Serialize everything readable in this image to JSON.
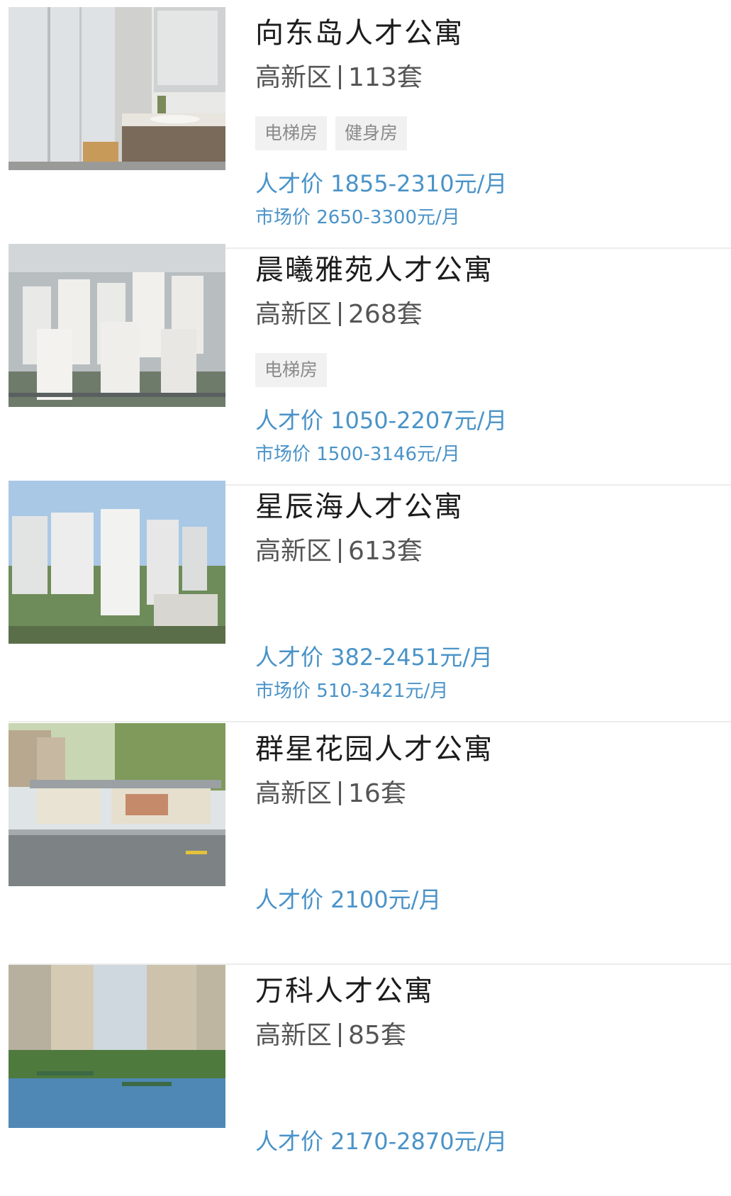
{
  "listings": [
    {
      "name": "向东岛人才公寓",
      "district": "高新区",
      "units": "113套",
      "tags": [
        "电梯房",
        "健身房"
      ],
      "talent_price": "人才价 1855-2310元/月",
      "market_price": "市场价 2650-3300元/月"
    },
    {
      "name": "晨曦雅苑人才公寓",
      "district": "高新区",
      "units": "268套",
      "tags": [
        "电梯房"
      ],
      "talent_price": "人才价 1050-2207元/月",
      "market_price": "市场价 1500-3146元/月"
    },
    {
      "name": "星辰海人才公寓",
      "district": "高新区",
      "units": "613套",
      "tags": [],
      "talent_price": "人才价 382-2451元/月",
      "market_price": "市场价 510-3421元/月"
    },
    {
      "name": "群星花园人才公寓",
      "district": "高新区",
      "units": "16套",
      "tags": [],
      "talent_price": "人才价 2100元/月",
      "market_price": ""
    },
    {
      "name": "万科人才公寓",
      "district": "高新区",
      "units": "85套",
      "tags": [],
      "talent_price": "人才价 2170-2870元/月",
      "market_price": ""
    }
  ]
}
